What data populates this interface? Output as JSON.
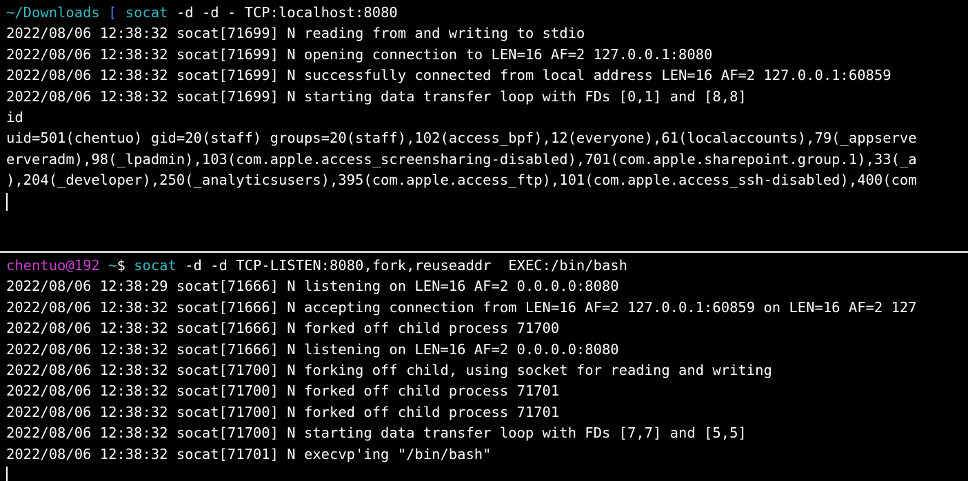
{
  "colors": {
    "background": "#000000",
    "text": "#ffffff",
    "prompt_path": "#35b9c4",
    "prompt_bracket": "#4d7cf0",
    "prompt_user": "#c93fd1",
    "divider": "#d0d0d0"
  },
  "top_pane": {
    "prompt": {
      "path": "~/Downloads",
      "bracket": "[",
      "command_name": "socat",
      "command_args": "-d -d - TCP:localhost:8080"
    },
    "output": [
      "2022/08/06 12:38:32 socat[71699] N reading from and writing to stdio",
      "2022/08/06 12:38:32 socat[71699] N opening connection to LEN=16 AF=2 127.0.0.1:8080",
      "2022/08/06 12:38:32 socat[71699] N successfully connected from local address LEN=16 AF=2 127.0.0.1:60859",
      "2022/08/06 12:38:32 socat[71699] N starting data transfer loop with FDs [0,1] and [8,8]",
      "id",
      "uid=501(chentuo) gid=20(staff) groups=20(staff),102(access_bpf),12(everyone),61(localaccounts),79(_appserve",
      "erveradm),98(_lpadmin),103(com.apple.access_screensharing-disabled),701(com.apple.sharepoint.group.1),33(_a",
      "),204(_developer),250(_analyticsusers),395(com.apple.access_ftp),101(com.apple.access_ssh-disabled),400(com"
    ]
  },
  "bottom_pane": {
    "prompt": {
      "user_host": "chentuo@192",
      "path": "~",
      "symbol": "$",
      "command_name": "socat",
      "command_args": "-d -d TCP-LISTEN:8080,fork,reuseaddr  EXEC:/bin/bash"
    },
    "output": [
      "2022/08/06 12:38:29 socat[71666] N listening on LEN=16 AF=2 0.0.0.0:8080",
      "2022/08/06 12:38:32 socat[71666] N accepting connection from LEN=16 AF=2 127.0.0.1:60859 on LEN=16 AF=2 127",
      "2022/08/06 12:38:32 socat[71666] N forked off child process 71700",
      "2022/08/06 12:38:32 socat[71666] N listening on LEN=16 AF=2 0.0.0.0:8080",
      "2022/08/06 12:38:32 socat[71700] N forking off child, using socket for reading and writing",
      "2022/08/06 12:38:32 socat[71700] N forked off child process 71701",
      "2022/08/06 12:38:32 socat[71700] N forked off child process 71701",
      "2022/08/06 12:38:32 socat[71700] N starting data transfer loop with FDs [7,7] and [5,5]",
      "2022/08/06 12:38:32 socat[71701] N execvp'ing \"/bin/bash\""
    ]
  }
}
